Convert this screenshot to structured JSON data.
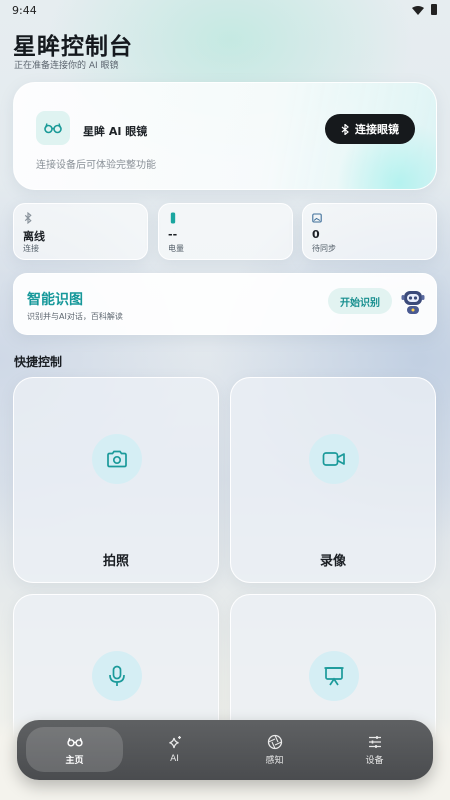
{
  "status_bar": {
    "time": "9:44"
  },
  "header": {
    "title": "星眸控制台",
    "subtitle": "正在准备连接你的 AI 眼镜"
  },
  "device": {
    "name": "星眸 AI 眼镜",
    "hint": "连接设备后可体验完整功能",
    "connect_label": "连接眼镜"
  },
  "stats": [
    {
      "value": "离线",
      "label": "连接",
      "icon": "bluetooth-icon"
    },
    {
      "value": "--",
      "label": "电量",
      "icon": "battery-icon"
    },
    {
      "value": "0",
      "label": "待同步",
      "icon": "image-icon"
    }
  ],
  "ai_card": {
    "title": "智能识图",
    "description": "识别并与AI对话，百科解读",
    "button_label": "开始识别"
  },
  "quick_controls": {
    "title": "快捷控制",
    "tiles": [
      {
        "label": "拍照",
        "icon": "camera-icon"
      },
      {
        "label": "录像",
        "icon": "video-icon"
      },
      {
        "label": "",
        "icon": "microphone-icon"
      },
      {
        "label": "",
        "icon": "projector-icon"
      }
    ]
  },
  "nav": {
    "items": [
      {
        "label": "主页",
        "icon": "glasses-icon",
        "active": true
      },
      {
        "label": "AI",
        "icon": "sparkle-icon",
        "active": false
      },
      {
        "label": "感知",
        "icon": "aperture-icon",
        "active": false
      },
      {
        "label": "设备",
        "icon": "sliders-icon",
        "active": false
      }
    ]
  },
  "colors": {
    "accent": "#16989a",
    "dark_button": "#16191c",
    "icon_circle": "#d5eef4"
  }
}
